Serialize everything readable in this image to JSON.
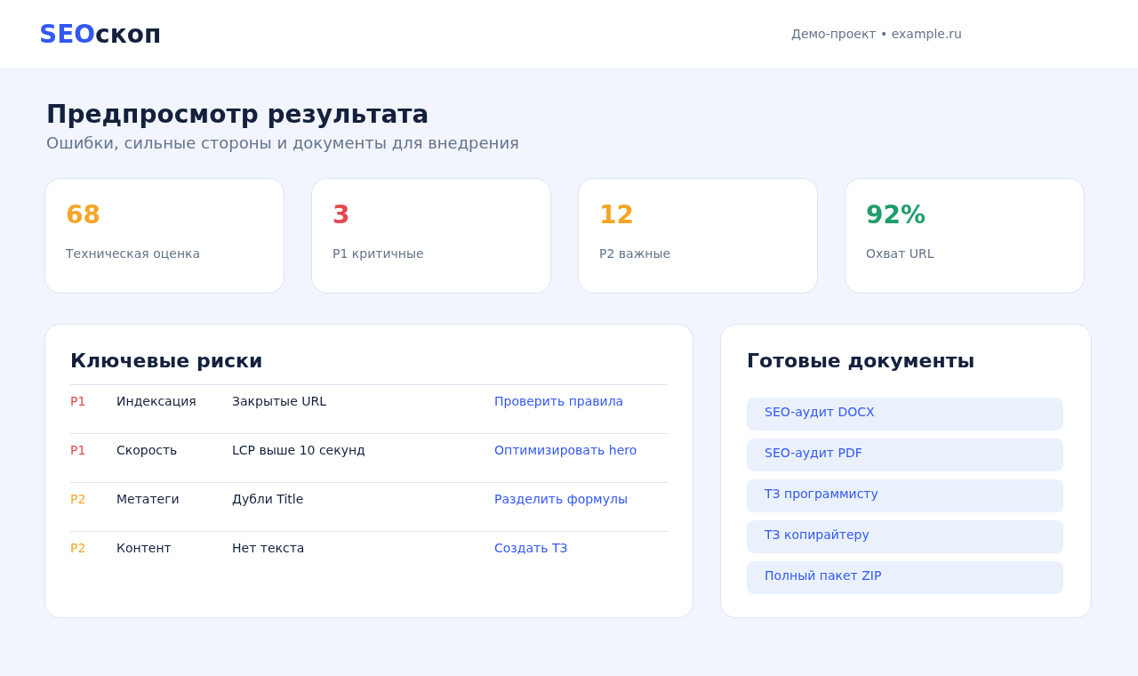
{
  "header": {
    "logo": {
      "accent": "SEO",
      "rest": "скоп"
    },
    "project": "Демо-проект • example.ru"
  },
  "page": {
    "title": "Предпросмотр результата",
    "subtitle": "Ошибки, сильные стороны и документы для внедрения"
  },
  "stats": [
    {
      "value": "68",
      "label": "Техническая оценка",
      "color": "#f5a524"
    },
    {
      "value": "3",
      "label": "P1 критичные",
      "color": "#e5484d"
    },
    {
      "value": "12",
      "label": "P2 важные",
      "color": "#f5a524"
    },
    {
      "value": "92%",
      "label": "Охват URL",
      "color": "#1f9d6b"
    }
  ],
  "risks": {
    "title": "Ключевые риски",
    "rows": [
      {
        "priority": "P1",
        "color": "#e5484d",
        "area": "Индексация",
        "issue": "Закрытые URL",
        "action": "Проверить правила"
      },
      {
        "priority": "P1",
        "color": "#e5484d",
        "area": "Скорость",
        "issue": "LCP выше 10 секунд",
        "action": "Оптимизировать hero"
      },
      {
        "priority": "P2",
        "color": "#f5a524",
        "area": "Метатеги",
        "issue": "Дубли Title",
        "action": "Разделить формулы"
      },
      {
        "priority": "P2",
        "color": "#f5a524",
        "area": "Контент",
        "issue": "Нет текста",
        "action": "Создать ТЗ"
      }
    ]
  },
  "documents": {
    "title": "Готовые документы",
    "items": [
      "SEO-аудит DOCX",
      "SEO-аудит PDF",
      "ТЗ программисту",
      "ТЗ копирайтеру",
      "Полный пакет ZIP"
    ]
  }
}
